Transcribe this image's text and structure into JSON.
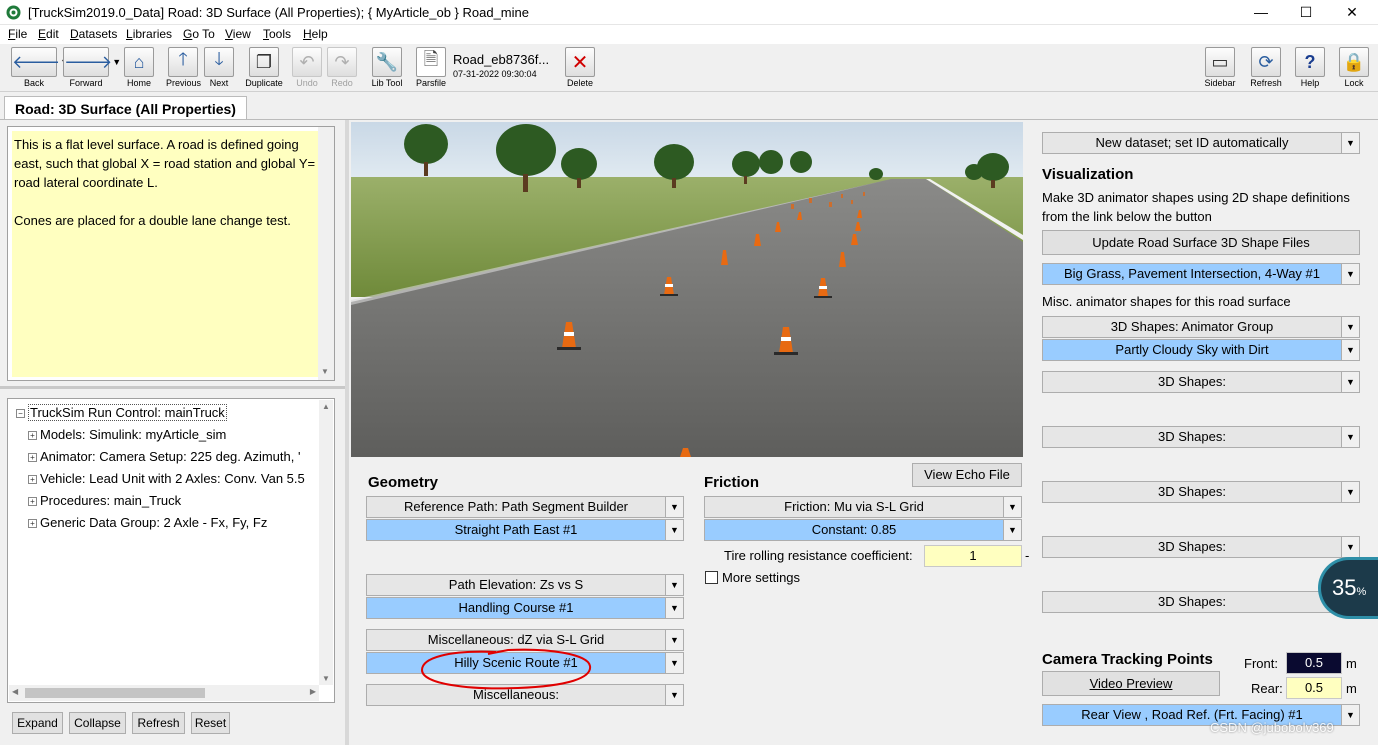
{
  "window": {
    "title": "[TruckSim2019.0_Data] Road: 3D Surface (All Properties); { MyArticle_ob } Road_mine",
    "minimize": "—",
    "maximize": "☐",
    "close": "✕"
  },
  "menu": [
    {
      "label": "File",
      "u": "F",
      "rest": "ile"
    },
    {
      "label": "Edit",
      "u": "E",
      "rest": "dit"
    },
    {
      "label": "Datasets",
      "u": "D",
      "rest": "atasets"
    },
    {
      "label": "Libraries",
      "u": "L",
      "rest": "ibraries"
    },
    {
      "label": "Go To",
      "u": "G",
      "rest": "o To"
    },
    {
      "label": "View",
      "u": "V",
      "rest": "iew"
    },
    {
      "label": "Tools",
      "u": "T",
      "rest": "ools"
    },
    {
      "label": "Help",
      "u": "H",
      "rest": "elp"
    }
  ],
  "toolbar": {
    "back": "Back",
    "forward": "Forward",
    "home": "Home",
    "previous": "Previous",
    "next": "Next",
    "duplicate": "Duplicate",
    "undo": "Undo",
    "redo": "Redo",
    "lib_tool": "Lib Tool",
    "parsfile": "Parsfile",
    "dataset_name": "Road_eb8736f...",
    "dataset_date": "07-31-2022 09:30:04",
    "delete": "Delete",
    "sidebar": "Sidebar",
    "refresh": "Refresh",
    "help": "Help",
    "lock": "Lock"
  },
  "page_tab": "Road: 3D Surface (All Properties)",
  "notes": {
    "line1": "This is a flat level surface. A road is defined going east, such that global X = road station and global Y= road lateral coordinate L.",
    "line2": "Cones are placed for a double lane change test."
  },
  "tree": {
    "root": "TruckSim Run Control: mainTruck",
    "items": [
      "Models: Simulink: myArticle_sim",
      "Animator: Camera Setup: 225 deg. Azimuth, '",
      "Vehicle: Lead Unit with 2 Axles: Conv. Van 5.5",
      "Procedures: main_Truck",
      "Generic Data Group: 2 Axle - Fx, Fy, Fz"
    ],
    "buttons": {
      "expand": "Expand",
      "collapse": "Collapse",
      "refresh": "Refresh",
      "reset": "Reset"
    }
  },
  "geometry": {
    "title": "Geometry",
    "ref_path_label": "Reference Path: Path Segment Builder",
    "ref_path_value": "Straight Path East #1",
    "elev_label": "Path Elevation: Zs vs S",
    "elev_value": "Handling Course #1",
    "misc_label": "Miscellaneous: dZ via S-L Grid",
    "misc_value": "Hilly Scenic Route #1",
    "misc2_label": "Miscellaneous:"
  },
  "friction": {
    "title": "Friction",
    "view_echo": "View Echo File",
    "label": "Friction: Mu via S-L Grid",
    "value": "Constant: 0.85",
    "trr_label": "Tire rolling resistance coefficient:",
    "trr_value": "1",
    "trr_unit": "-",
    "more_settings": "More settings"
  },
  "right": {
    "new_dataset": "New dataset; set ID automatically",
    "vis_title": "Visualization",
    "vis_desc": "Make 3D animator shapes using 2D shape definitions from the link below the button",
    "update_btn": "Update Road Surface 3D Shape Files",
    "shape_value": "Big Grass, Pavement Intersection, 4-Way #1",
    "misc_label": "Misc. animator shapes for this road surface",
    "group_label": "3D Shapes: Animator Group",
    "group_value": "Partly Cloudy Sky with Dirt",
    "shapes": [
      "3D Shapes:",
      "3D Shapes:",
      "3D Shapes:",
      "3D Shapes:",
      "3D Shapes:"
    ],
    "camera_title": "Camera Tracking Points",
    "front_label": "Front:",
    "front_value": "0.5",
    "rear_label": "Rear:",
    "rear_value": "0.5",
    "unit_m": "m",
    "video_preview": "Video Preview",
    "camera_value": "Rear View , Road Ref. (Frt. Facing) #1"
  },
  "overlay": {
    "percent": "35",
    "percent_sign": "%",
    "watermark": "CSDN @jubobolv369"
  },
  "colors": {
    "selected_blue": "#99ccff",
    "note_yellow": "#ffffc0",
    "annotation_red": "#e00000"
  }
}
